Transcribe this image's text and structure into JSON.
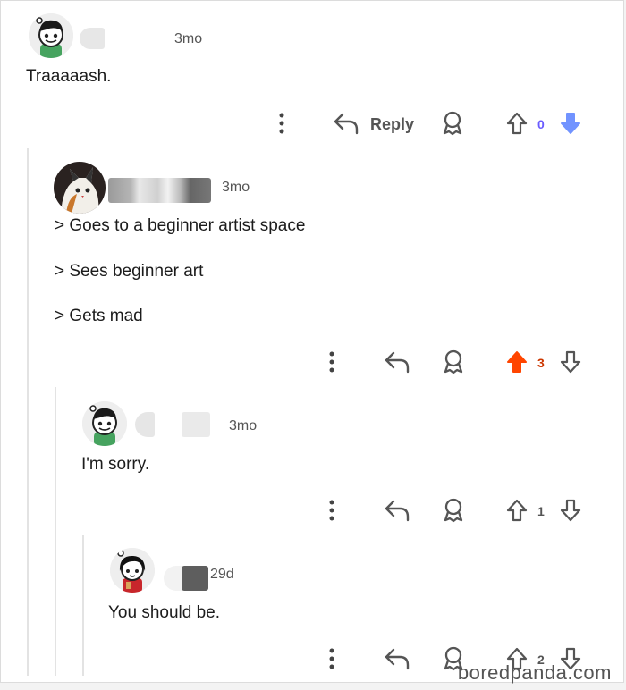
{
  "comments": [
    {
      "time": "3mo",
      "body": [
        "Traaaaash."
      ],
      "reply_label": "Reply",
      "score": "0",
      "vote_state": "downvoted",
      "avatar": "snoo-default-green-shirt"
    },
    {
      "time": "3mo",
      "body": [
        "> Goes to a beginner artist space",
        "> Sees beginner art",
        "> Gets mad"
      ],
      "score": "3",
      "vote_state": "upvoted",
      "avatar": "cat-portrait"
    },
    {
      "time": "3mo",
      "body": [
        "I'm sorry."
      ],
      "score": "1",
      "vote_state": "none",
      "avatar": "snoo-default-green-shirt"
    },
    {
      "time": "29d",
      "body": [
        "You should be."
      ],
      "score": "2",
      "vote_state": "none",
      "avatar": "snoo-red-dress"
    }
  ],
  "icons": {
    "more": "more-vertical-icon",
    "reply": "reply-arrow-icon",
    "award": "award-icon",
    "upvote": "upvote-arrow-icon",
    "downvote": "downvote-arrow-icon"
  },
  "colors": {
    "upvote_active": "#ff4500",
    "downvote_active": "#7193ff",
    "upvote_count": "#cc3700",
    "downvote_count": "#6a5cff",
    "icon": "#555555",
    "thread_line": "#e3e3e3"
  },
  "watermark": "boredpanda.com"
}
